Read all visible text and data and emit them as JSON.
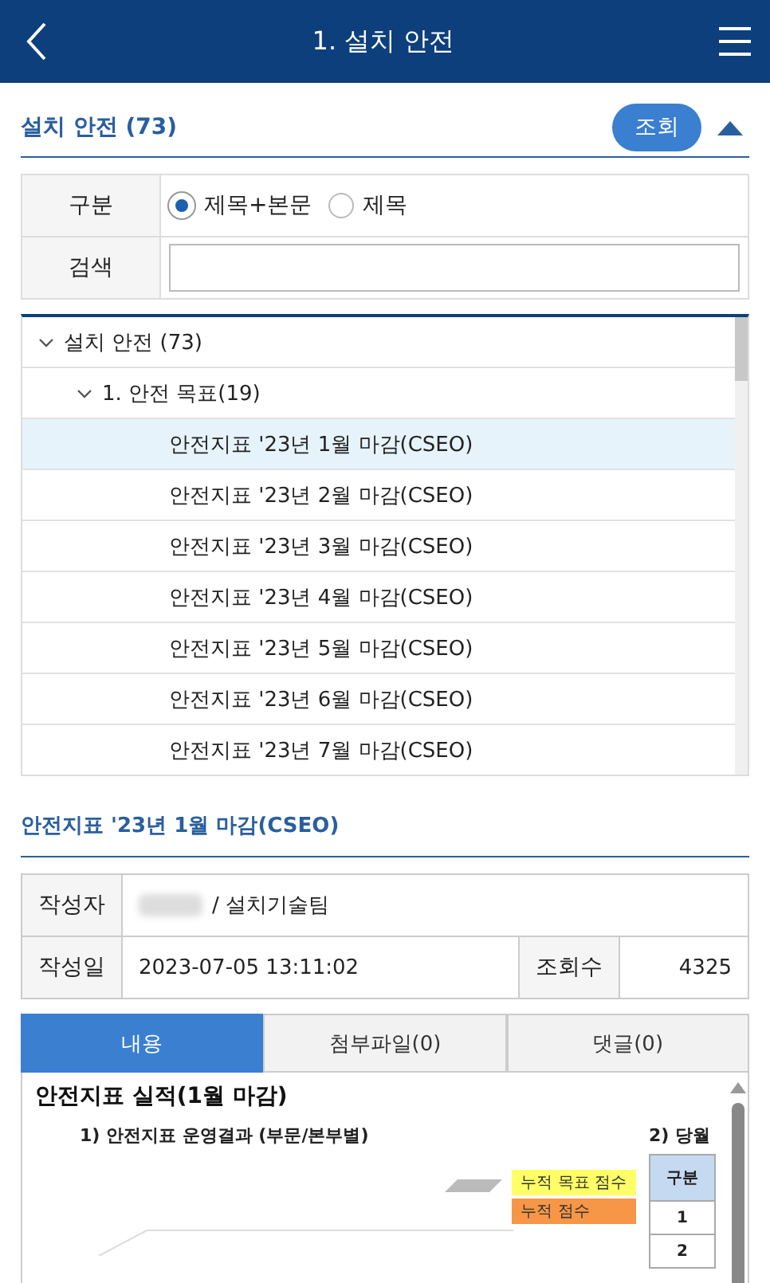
{
  "header": {
    "title": "1. 설치 안전"
  },
  "section": {
    "title": "설치 안전 (73)",
    "button": "조회",
    "expanded": true
  },
  "search_type": {
    "label": "구분",
    "options": [
      {
        "label": "제목+본문",
        "selected": true
      },
      {
        "label": "제목",
        "selected": false
      }
    ]
  },
  "search": {
    "label": "검색"
  },
  "tree": [
    {
      "label": "설치 안전 (73)",
      "expanded": true,
      "selected": false,
      "children": [
        {
          "label": "1. 안전 목표(19)",
          "expanded": true,
          "selected": false,
          "children": [
            {
              "label": "안전지표 '23년 1월 마감(CSEO)",
              "selected": true
            },
            {
              "label": "안전지표 '23년 2월 마감(CSEO)",
              "selected": false
            },
            {
              "label": "안전지표 '23년 3월 마감(CSEO)",
              "selected": false
            },
            {
              "label": "안전지표 '23년 4월 마감(CSEO)",
              "selected": false
            },
            {
              "label": "안전지표 '23년 5월 마감(CSEO)",
              "selected": false
            },
            {
              "label": "안전지표 '23년 6월 마감(CSEO)",
              "selected": false
            },
            {
              "label": "안전지표 '23년 7월 마감(CSEO)",
              "selected": false
            }
          ]
        }
      ]
    }
  ],
  "detail": {
    "title": "안전지표 '23년 1월 마감(CSEO)",
    "author_label": "작성자",
    "author_team": "/ 설치기술팀",
    "date_label": "작성일",
    "date": "2023-07-05 13:11:02",
    "views_label": "조회수",
    "views": "4325"
  },
  "tabs": [
    {
      "label": "내용",
      "selected": true
    },
    {
      "label": "첨부파일(0)",
      "selected": false
    },
    {
      "label": "댓글(0)",
      "selected": false
    }
  ],
  "content": {
    "title": "안전지표 실적(1월 마감)",
    "subtitle_1": "1) 안전지표 운영결과 (부문/본부별)",
    "subtitle_2": "2) 당월",
    "legend": [
      {
        "label": "누적 목표 점수",
        "color": "#ffff66"
      },
      {
        "label": "누적 점수",
        "color": "#f79646"
      }
    ],
    "table": {
      "header": "구분",
      "rows": [
        "1",
        "2"
      ]
    }
  }
}
